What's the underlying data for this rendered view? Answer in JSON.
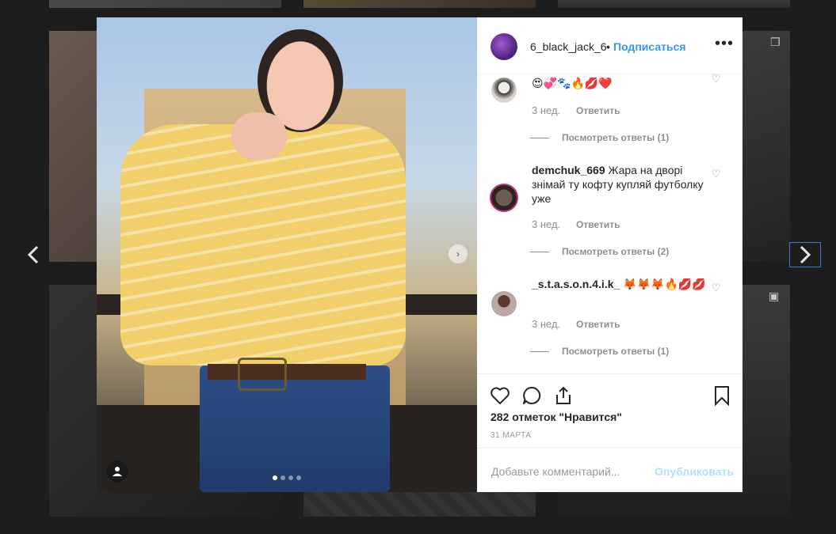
{
  "post": {
    "username": "6_black_jack_6",
    "separator": "•",
    "follow_label": "Подписаться",
    "more_label": "•••",
    "likes": "282 отметок \"Нравится\"",
    "date": "31 МАРТА",
    "slide_count": 4,
    "active_slide": 1
  },
  "comments": [
    {
      "username": "",
      "text": "😍💞🐾🔥💋❤️",
      "time": "3 нед.",
      "reply_label": "Ответить",
      "view_replies": "Посмотреть ответы (1)"
    },
    {
      "username": "demchuk_669",
      "text": "Жара на дворі знімай ту кофту купляй футболку уже",
      "time": "3 нед.",
      "reply_label": "Ответить",
      "view_replies": "Посмотреть ответы (2)"
    },
    {
      "username": "_s.t.a.s.o.n.4.i.k_",
      "text": "🦊🦊🦊🔥💋💋",
      "time": "3 нед.",
      "reply_label": "Ответить",
      "view_replies": "Посмотреть ответы (1)"
    }
  ],
  "add_comment": {
    "placeholder": "Добавьте комментарий...",
    "publish_label": "Опубликовать"
  },
  "icons": {
    "nav_prev": "chevron-left-icon",
    "nav_next": "chevron-right-icon",
    "like": "heart-icon",
    "comment": "comment-icon",
    "share": "share-icon",
    "save": "bookmark-icon",
    "user_tag": "user-icon",
    "multi_photo": "carousel-icon",
    "video": "video-icon"
  },
  "colors": {
    "accent": "#3897f0",
    "publish_disabled": "#b2dffc",
    "text": "#262626",
    "muted": "#8e8e8e"
  }
}
